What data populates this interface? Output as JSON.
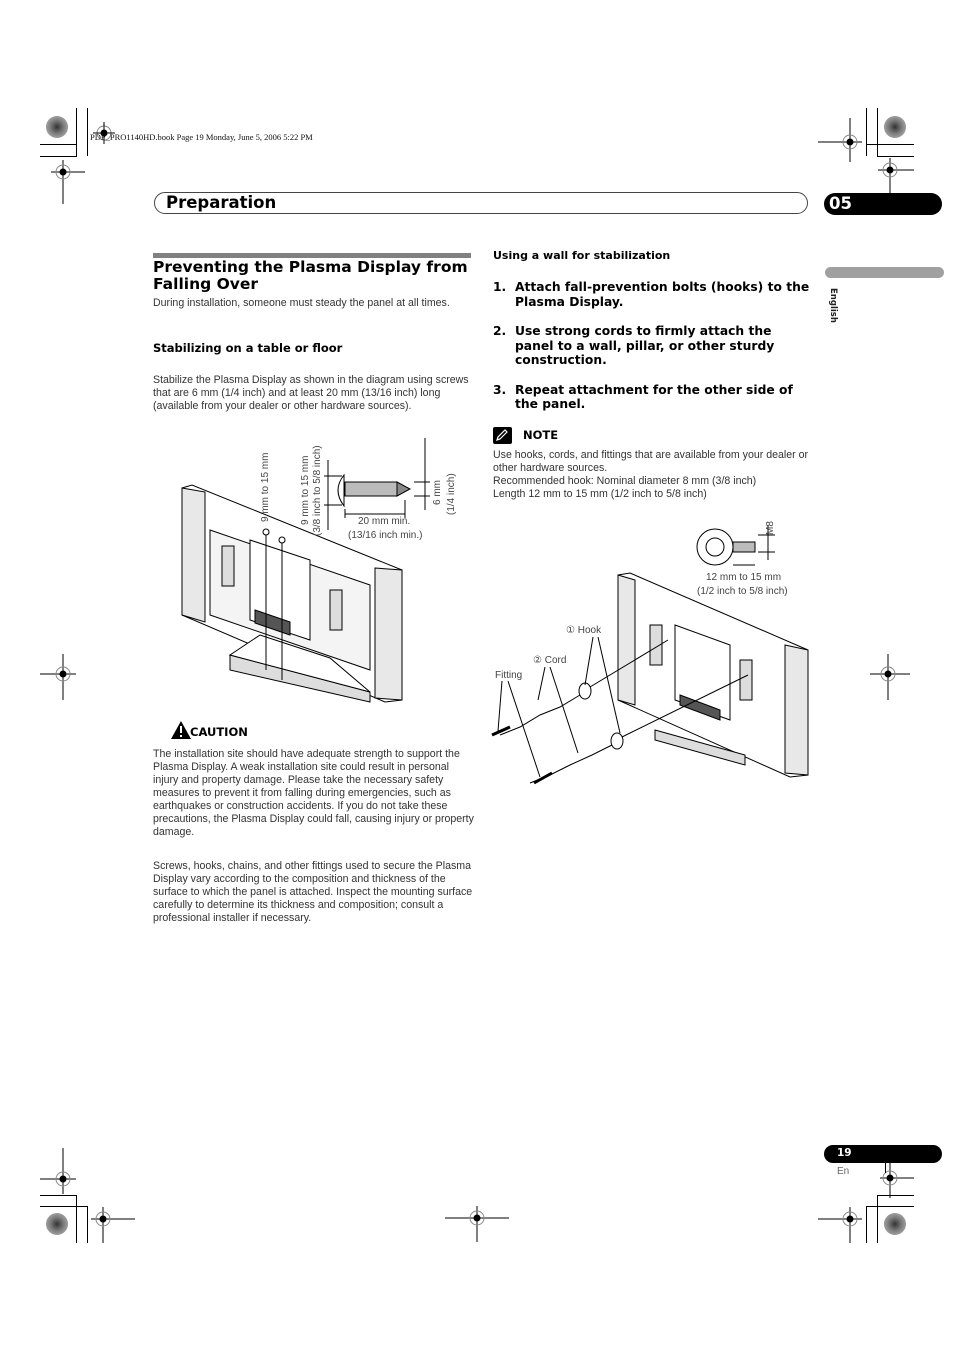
{
  "print_info": "PDP_PRO1140HD.book  Page 19  Monday, June 5, 2006  5:22 PM",
  "header": {
    "title": "Preparation",
    "chapter": "05"
  },
  "side_tab": {
    "language": "English"
  },
  "left": {
    "section_title": "Preventing the Plasma Display from Falling Over",
    "intro": "During installation, someone must steady the panel at all times.",
    "stabilizing_heading": "Stabilizing on a table or floor",
    "stabilizing_text": "Stabilize the Plasma Display as shown in the diagram using screws that are 6 mm (1/4 inch) and at least 20 mm (13/16 inch) long (available from your dealer or other hardware sources).",
    "screw_diagram": {
      "head_height_line1": "9 mm to 15 mm",
      "head_height_line2": "(3/8 inch to 5/8 inch)",
      "diameter_line1": "6 mm",
      "diameter_line2": "(1/4 inch)",
      "length_line1": "20 mm min.",
      "length_line2": "(13/16 inch min.)"
    },
    "caution": {
      "label": "CAUTION",
      "icon": "warning-triangle-icon",
      "text": "The installation site should have adequate strength to support the Plasma Display. A weak installation site could result in personal injury and property damage. Please take the necessary safety measures to prevent it from falling during emergencies, such as earthquakes or construction accidents. If you do not take these precautions, the Plasma Display could fall, causing injury or property damage."
    },
    "fittings_text": "Screws, hooks, chains, and other fittings used to secure the Plasma Display vary according to the composition and thickness of the surface to which the panel is attached. Inspect the mounting surface carefully to determine its thickness and composition; consult a professional installer if necessary."
  },
  "right": {
    "wall_heading": "Using a wall for stabilization",
    "steps": [
      {
        "num": "1.",
        "text": "Attach fall-prevention bolts (hooks) to the Plasma Display."
      },
      {
        "num": "2.",
        "text": "Use strong cords to firmly attach the panel to a wall, pillar, or other sturdy construction."
      },
      {
        "num": "3.",
        "text": "Repeat attachment for the other side of the panel."
      }
    ],
    "note": {
      "label": "NOTE",
      "icon": "pencil-note-icon",
      "lines": [
        "Use hooks, cords, and fittings that are available from your dealer or other hardware sources.",
        "Recommended hook: Nominal diameter 8 mm (3/8 inch)",
        "Length 12 mm to 15 mm (1/2 inch to 5/8 inch)"
      ]
    },
    "hook_diagram": {
      "thread": "M8",
      "length_line1": "12 mm to 15 mm",
      "length_line2": "(1/2 inch to 5/8 inch)",
      "hook_label": "① Hook",
      "cord_label": "② Cord",
      "fitting_label": "Fitting"
    }
  },
  "footer": {
    "page_number": "19",
    "language_code": "En"
  }
}
